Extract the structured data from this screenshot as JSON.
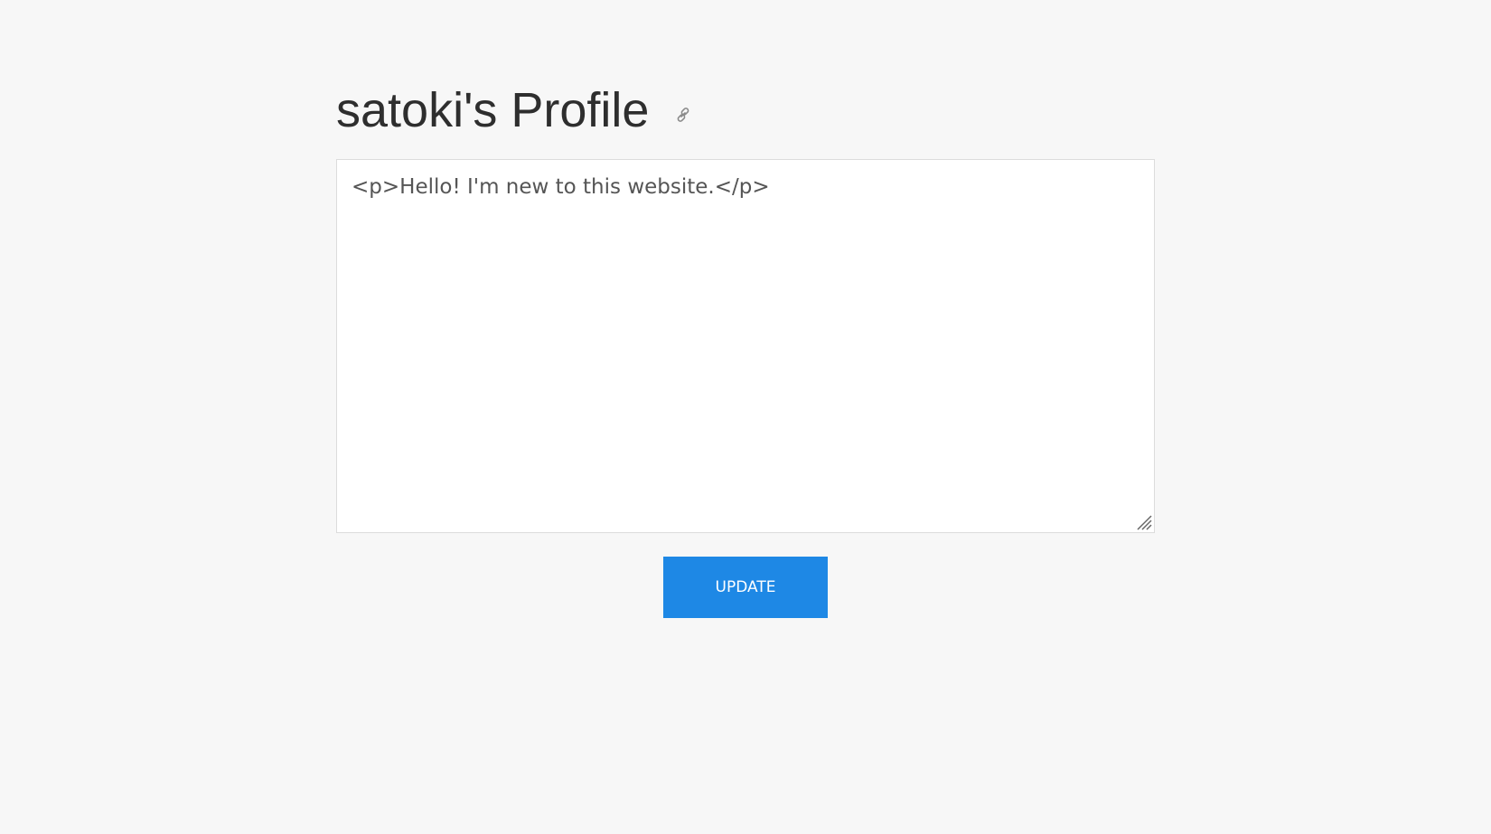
{
  "profile": {
    "title": "satoki's Profile",
    "link_icon": "link-icon"
  },
  "editor": {
    "content": "<p>Hello! I'm new to this website.</p>",
    "resize_icon": "resize-grip-icon"
  },
  "actions": {
    "update_label": "UPDATE"
  },
  "colors": {
    "background": "#f7f7f7",
    "title_text": "#2e2e2e",
    "editor_text": "#555555",
    "button_bg": "#1e88e5",
    "button_text": "#ffffff"
  }
}
